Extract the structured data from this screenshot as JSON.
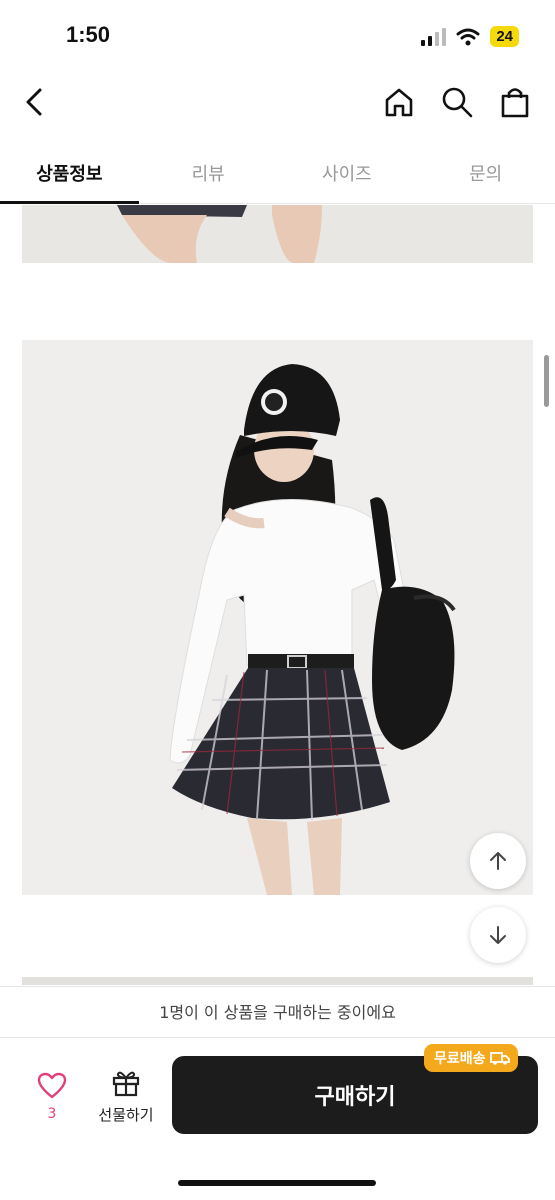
{
  "status_bar": {
    "time": "1:50",
    "battery": "24"
  },
  "nav": {
    "back_icon": "chevron-left-icon",
    "home_icon": "home-icon",
    "search_icon": "search-icon",
    "bag_icon": "shopping-bag-icon"
  },
  "tabs": [
    {
      "label": "상품정보",
      "active": true
    },
    {
      "label": "리뷰",
      "active": false
    },
    {
      "label": "사이즈",
      "active": false
    },
    {
      "label": "문의",
      "active": false
    }
  ],
  "viewer_notice": "1명이 이 상품을 구매하는 중이에요",
  "bottom": {
    "like_count": "3",
    "gift_label": "선물하기",
    "buy_label": "구매하기",
    "shipping_badge": "무료배송"
  },
  "colors": {
    "accent_pink": "#e0417a",
    "badge_orange": "#f4a81c",
    "buy_bg": "#1c1c1c"
  }
}
